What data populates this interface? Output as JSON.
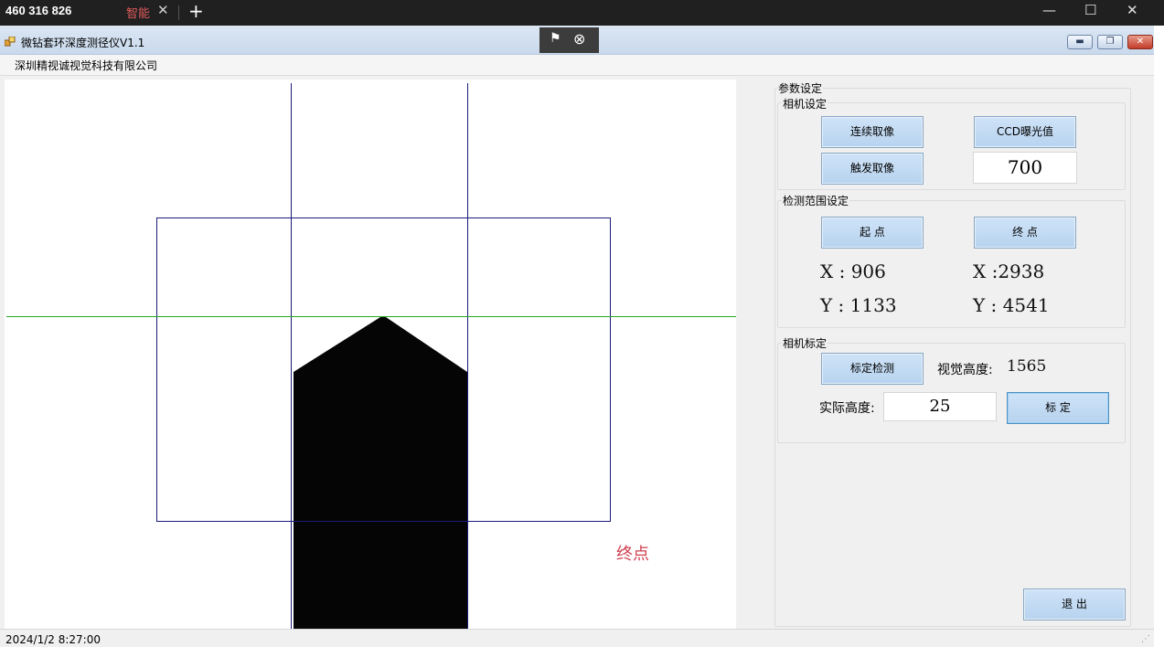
{
  "remote": {
    "connection_id": "460 316 826",
    "tab_label": "智能",
    "tab_close_icon": "close-icon",
    "new_tab_icon": "plus-icon"
  },
  "window": {
    "title": "微钻套环深度测径仪V1.1",
    "menu_company": "深圳精视诚视觉科技有限公司",
    "accent_color": "#b7d3ef"
  },
  "viewer": {
    "end_label": "终点"
  },
  "panel": {
    "title": "参数设定",
    "camera": {
      "title": "相机设定",
      "continuous_btn": "连续取像",
      "exposure_btn": "CCD曝光值",
      "trigger_btn": "触发取像",
      "exposure_value": "700"
    },
    "range": {
      "title": "检测范围设定",
      "start_btn": "起  点",
      "end_btn": "终  点",
      "start_x": "X : 906",
      "start_y": "Y : 1133",
      "end_x": "X :2938",
      "end_y": "Y : 4541"
    },
    "calib": {
      "title": "相机标定",
      "detect_btn": "标定检测",
      "visual_height_label": "视觉高度:",
      "visual_height_value": "1565",
      "actual_height_label": "实际高度:",
      "actual_height_value": "25",
      "calibrate_btn": "标  定"
    },
    "exit_btn": "退  出"
  },
  "status": {
    "datetime": "2024/1/2 8:27:00"
  }
}
